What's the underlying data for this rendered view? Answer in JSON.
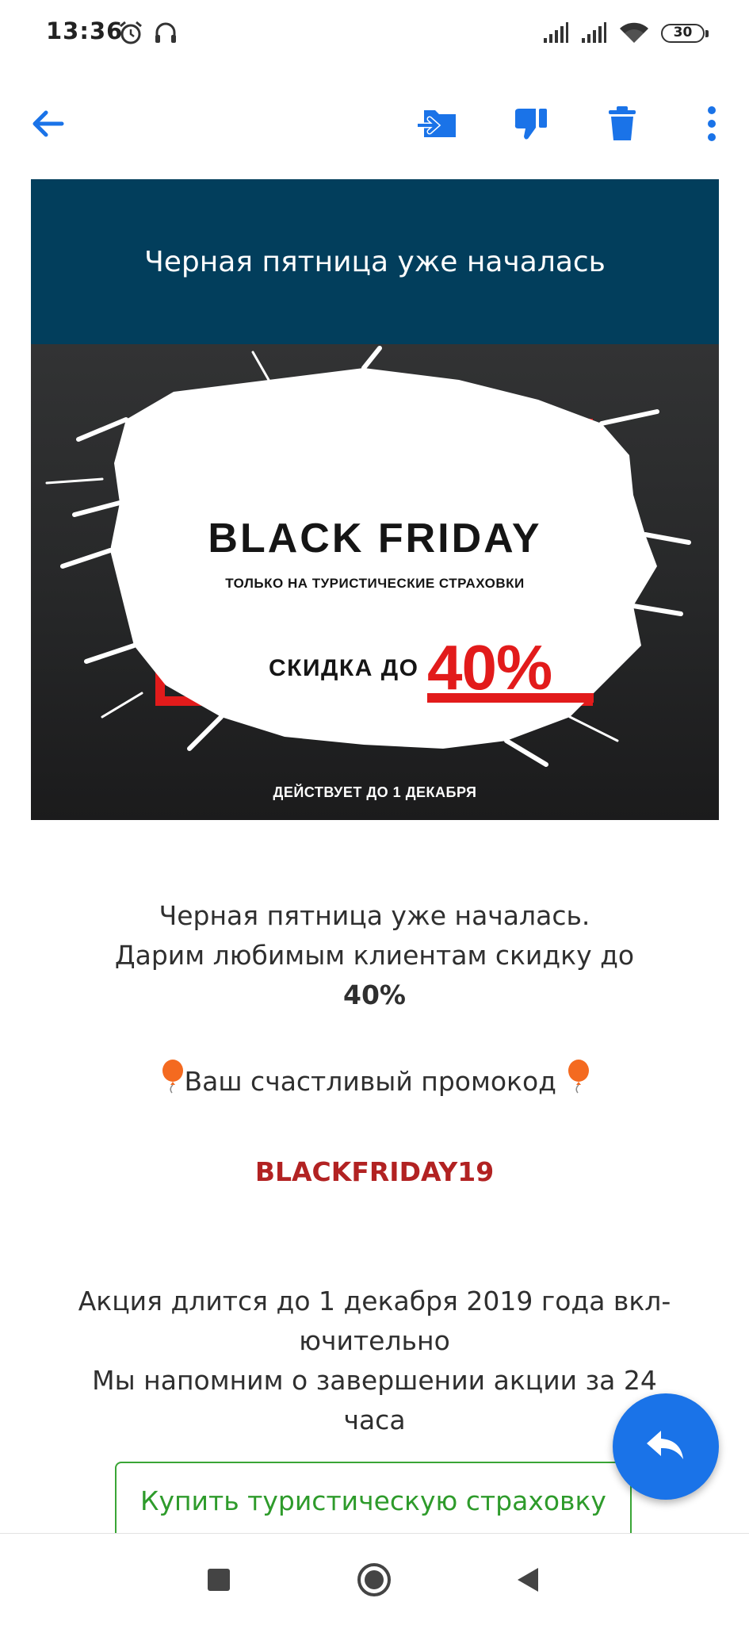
{
  "status_bar": {
    "time": "13:36",
    "battery": "30",
    "icons": [
      "alarm-icon",
      "headphones-icon",
      "signal-icon",
      "signal-icon",
      "wifi-icon",
      "battery-icon"
    ]
  },
  "app_bar": {
    "icons": [
      "back-arrow-icon",
      "move-to-folder-icon",
      "spam-thumbs-down-icon",
      "trash-icon",
      "more-vert-icon"
    ],
    "accent_color": "#1a73e8"
  },
  "email": {
    "header_title": "Черная пятница уже началась",
    "banner": {
      "title": "BLACK FRIDAY",
      "subtitle": "ТОЛЬКО НА ТУРИСТИЧЕСКИЕ СТРАХОВКИ",
      "discount_label": "СКИДКА ДО",
      "discount_value": "40%",
      "valid_until": "ДЕЙСТВУЕТ ДО 1 ДЕКАБРЯ"
    },
    "intro_line1": "Черная пятница уже началась.",
    "intro_line2": "Дарим любимым клиентам скидку до",
    "intro_bold": "40%",
    "promo_label": "Ваш счастливый промокод",
    "promo_code": "BLACKFRIDAY19",
    "terms_line1": "Акция длится до 1 декабря 2019 года вкл-",
    "terms_line2": "ючительно",
    "terms_line3": "Мы напомним о завершении акции за 24",
    "terms_line4": "часа",
    "cta_label": "Купить туристическую страховку",
    "colors": {
      "header_bg": "#023e5c",
      "promo": "#b22222",
      "cta": "#3aa536",
      "discount": "#e21b1b"
    }
  },
  "fab": {
    "icon": "reply-icon"
  },
  "nav_bar": {
    "icons": [
      "recent-apps-icon",
      "home-icon",
      "back-icon"
    ]
  }
}
